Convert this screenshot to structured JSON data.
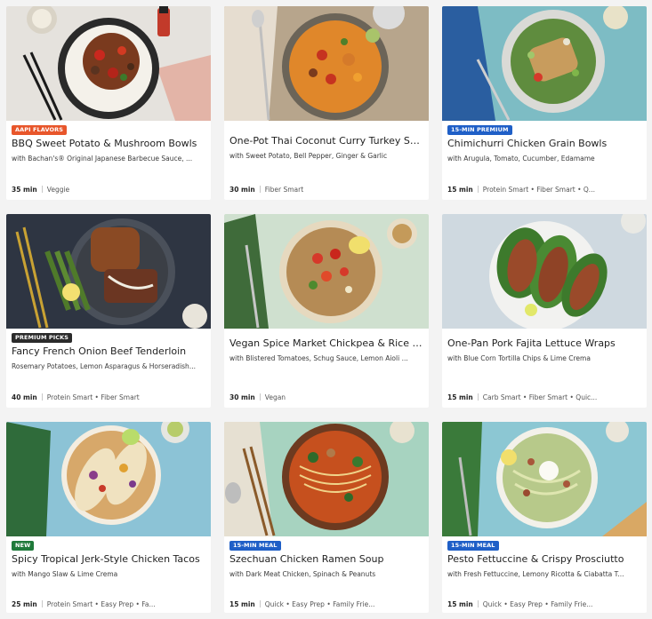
{
  "colors": {
    "badge_orange": "#e8562b",
    "badge_dark": "#2b2b2b",
    "badge_blue": "#1f5fc7",
    "badge_green": "#1f7a3a"
  },
  "cards": [
    {
      "badge": "AAPI FLAVORS",
      "badge_color": "#e8562b",
      "title": "BBQ Sweet Potato & Mushroom Bowls",
      "subtitle": "with Bachan's® Original Japanese Barbecue Sauce, ...",
      "time": "35 min",
      "tags": "Veggie",
      "photo": "bbq-bowl-photo"
    },
    {
      "badge": "",
      "badge_color": "",
      "title": "One-Pot Thai Coconut Curry Turkey Soup",
      "subtitle": "with Sweet Potato, Bell Pepper, Ginger & Garlic",
      "time": "30 min",
      "tags": "Fiber Smart",
      "photo": "curry-soup-photo"
    },
    {
      "badge": "15-MIN PREMIUM",
      "badge_color": "#1f5fc7",
      "title": "Chimichurri Chicken Grain Bowls",
      "subtitle": "with Arugula, Tomato, Cucumber, Edamame",
      "time": "15 min",
      "tags": "Protein Smart • Fiber Smart • Q...",
      "photo": "grain-bowl-photo"
    },
    {
      "badge": "PREMIUM PICKS",
      "badge_color": "#2b2b2b",
      "title": "Fancy French Onion Beef Tenderloin",
      "subtitle": "Rosemary Potatoes, Lemon Asparagus & Horseradish...",
      "time": "40 min",
      "tags": "Protein Smart • Fiber Smart",
      "photo": "beef-tenderloin-photo"
    },
    {
      "badge": "",
      "badge_color": "",
      "title": "Vegan Spice Market Chickpea & Rice Bo...",
      "subtitle": "with Blistered Tomatoes, Schug Sauce, Lemon Aioli ...",
      "time": "30 min",
      "tags": "Vegan",
      "photo": "chickpea-bowl-photo"
    },
    {
      "badge": "",
      "badge_color": "",
      "title": "One-Pan Pork Fajita Lettuce Wraps",
      "subtitle": "with Blue Corn Tortilla Chips & Lime Crema",
      "time": "15 min",
      "tags": "Carb Smart • Fiber Smart • Quic...",
      "photo": "lettuce-wraps-photo"
    },
    {
      "badge": "NEW",
      "badge_color": "#1f7a3a",
      "title": "Spicy Tropical Jerk-Style Chicken Tacos",
      "subtitle": "with Mango Slaw & Lime Crema",
      "time": "25 min",
      "tags": "Protein Smart • Easy Prep • Fa...",
      "photo": "tacos-photo"
    },
    {
      "badge": "15-MIN MEAL",
      "badge_color": "#1f5fc7",
      "title": "Szechuan Chicken Ramen Soup",
      "subtitle": "with Dark Meat Chicken, Spinach & Peanuts",
      "time": "15 min",
      "tags": "Quick • Easy Prep • Family Frie...",
      "photo": "ramen-photo"
    },
    {
      "badge": "15-MIN MEAL",
      "badge_color": "#1f5fc7",
      "title": "Pesto Fettuccine & Crispy Prosciutto",
      "subtitle": "with Fresh Fettuccine, Lemony Ricotta & Ciabatta T...",
      "time": "15 min",
      "tags": "Quick • Easy Prep • Family Frie...",
      "photo": "fettuccine-photo"
    }
  ]
}
